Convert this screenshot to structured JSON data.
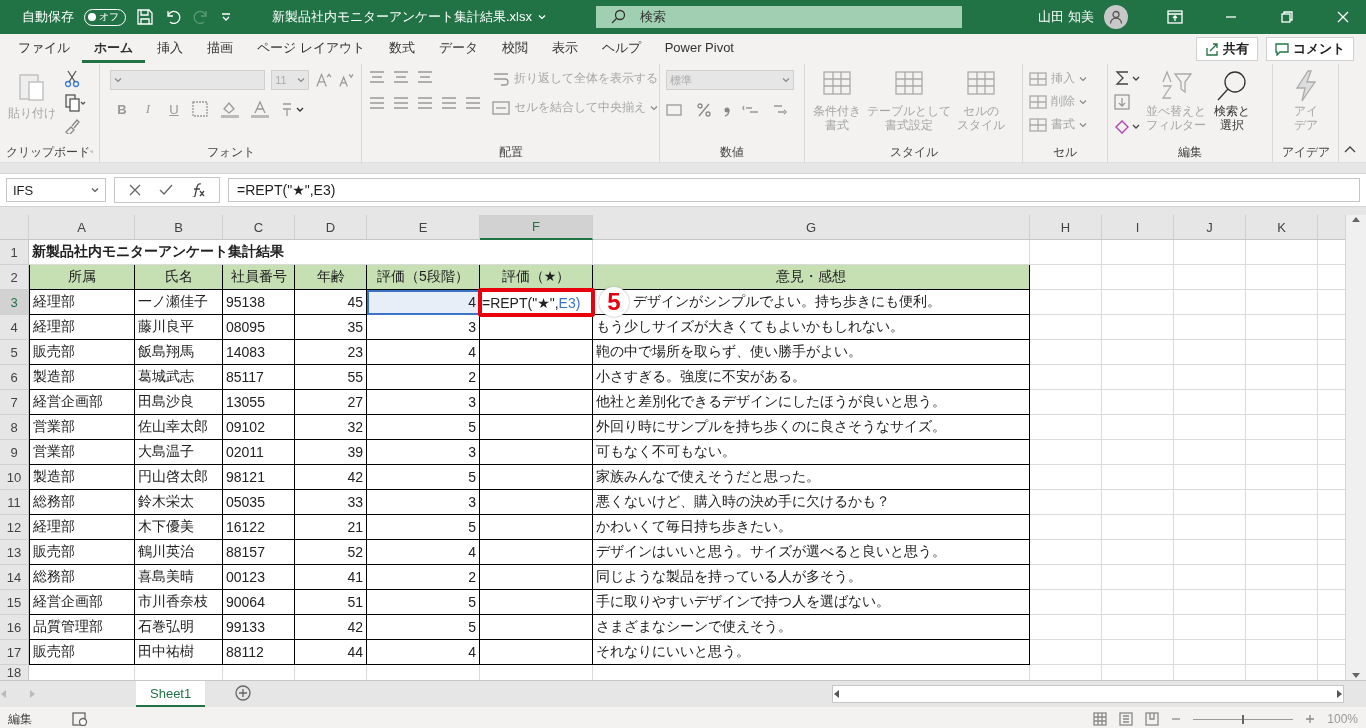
{
  "title_bar": {
    "autosave_label": "自動保存",
    "autosave_toggle": {
      "label": "オフ",
      "on": false
    },
    "file_name": "新製品社内モニターアンケート集計結果.xlsx",
    "search_placeholder": "検索",
    "user_name": "山田 知美"
  },
  "menu_tabs": [
    {
      "label": "ファイル",
      "selected": false
    },
    {
      "label": "ホーム",
      "selected": true
    },
    {
      "label": "挿入",
      "selected": false
    },
    {
      "label": "描画",
      "selected": false
    },
    {
      "label": "ページ レイアウト",
      "selected": false
    },
    {
      "label": "数式",
      "selected": false
    },
    {
      "label": "データ",
      "selected": false
    },
    {
      "label": "校閲",
      "selected": false
    },
    {
      "label": "表示",
      "selected": false
    },
    {
      "label": "ヘルプ",
      "selected": false
    },
    {
      "label": "Power Pivot",
      "selected": false
    }
  ],
  "share_button": "共有",
  "comment_button": "コメント",
  "ribbon": {
    "clipboard": {
      "title": "クリップボード",
      "paste": {
        "label": "貼り付け",
        "disabled": true
      }
    },
    "font": {
      "title": "フォント",
      "font_size": "11",
      "format_buttons": [
        "B",
        "I",
        "U"
      ]
    },
    "alignment": {
      "title": "配置",
      "wrap": {
        "label": "折り返して全体を表示する",
        "disabled": true
      },
      "merge": {
        "label": "セルを結合して中央揃え",
        "disabled": true
      }
    },
    "number": {
      "title": "数値",
      "format": "標準"
    },
    "styles": {
      "title": "スタイル",
      "buttons": [
        {
          "lines": [
            "条件付き",
            "書式"
          ],
          "disabled": true
        },
        {
          "lines": [
            "テーブルとして",
            "書式設定"
          ],
          "disabled": true
        },
        {
          "lines": [
            "セルの",
            "スタイル"
          ],
          "disabled": true
        }
      ]
    },
    "cells": {
      "title": "セル",
      "buttons": [
        {
          "label": "挿入",
          "disabled": true
        },
        {
          "label": "削除",
          "disabled": true
        },
        {
          "label": "書式",
          "disabled": true
        }
      ]
    },
    "editing": {
      "title": "編集",
      "buttons": [
        {
          "lines": [
            "並べ替えと",
            "フィルター"
          ],
          "disabled": true
        },
        {
          "lines": [
            "検索と",
            "選択"
          ],
          "disabled": false
        }
      ]
    },
    "ideas": {
      "title": "アイデア",
      "button": {
        "lines": [
          "アイ",
          "デア"
        ],
        "disabled": true
      }
    }
  },
  "formula_bar": {
    "name_box": "IFS",
    "formula": "=REPT(\"★\",E3)"
  },
  "columns": [
    {
      "label": "A",
      "selected": false
    },
    {
      "label": "B",
      "selected": false
    },
    {
      "label": "C",
      "selected": false
    },
    {
      "label": "D",
      "selected": false
    },
    {
      "label": "E",
      "selected": false
    },
    {
      "label": "F",
      "selected": true
    },
    {
      "label": "G",
      "selected": false
    },
    {
      "label": "H",
      "selected": false
    },
    {
      "label": "I",
      "selected": false
    },
    {
      "label": "J",
      "selected": false
    },
    {
      "label": "K",
      "selected": false
    }
  ],
  "rows": [
    {
      "number": "1",
      "selected": false,
      "kind": "title",
      "title": "新製品社内モニターアンケート集計結果"
    },
    {
      "number": "2",
      "selected": false,
      "kind": "header",
      "cells": [
        "所属",
        "氏名",
        "社員番号",
        "年齢",
        "評価（5段階）",
        "評価（★）",
        "意見・感想"
      ]
    },
    {
      "number": "3",
      "selected": true,
      "kind": "data",
      "referenced": true,
      "dept": "経理部",
      "name": "一ノ瀬佳子",
      "id": "95138",
      "age": "45",
      "rating": "4",
      "editing": [
        {
          "text": "=REPT(\"★\","
        },
        {
          "text": "E3)",
          "kind": "reference"
        }
      ],
      "comment": "デザインがシンプルでよい。持ち歩きにも便利。",
      "callout": "5"
    },
    {
      "number": "4",
      "selected": false,
      "kind": "data",
      "referenced": false,
      "dept": "経理部",
      "name": "藤川良平",
      "id": "08095",
      "age": "35",
      "rating": "3",
      "comment": "もう少しサイズが大きくてもよいかもしれない。"
    },
    {
      "number": "5",
      "selected": false,
      "kind": "data",
      "referenced": false,
      "dept": "販売部",
      "name": "飯島翔馬",
      "id": "14083",
      "age": "23",
      "rating": "4",
      "comment": "鞄の中で場所を取らず、使い勝手がよい。"
    },
    {
      "number": "6",
      "selected": false,
      "kind": "data",
      "referenced": false,
      "dept": "製造部",
      "name": "葛城武志",
      "id": "85117",
      "age": "55",
      "rating": "2",
      "comment": "小さすぎる。強度に不安がある。"
    },
    {
      "number": "7",
      "selected": false,
      "kind": "data",
      "referenced": false,
      "dept": "経営企画部",
      "name": "田島沙良",
      "id": "13055",
      "age": "27",
      "rating": "3",
      "comment": "他社と差別化できるデザインにしたほうが良いと思う。"
    },
    {
      "number": "8",
      "selected": false,
      "kind": "data",
      "referenced": false,
      "dept": "営業部",
      "name": "佐山幸太郎",
      "id": "09102",
      "age": "32",
      "rating": "5",
      "comment": "外回り時にサンプルを持ち歩くのに良さそうなサイズ。"
    },
    {
      "number": "9",
      "selected": false,
      "kind": "data",
      "referenced": false,
      "dept": "営業部",
      "name": "大島温子",
      "id": "02011",
      "age": "39",
      "rating": "3",
      "comment": "可もなく不可もない。"
    },
    {
      "number": "10",
      "selected": false,
      "kind": "data",
      "referenced": false,
      "dept": "製造部",
      "name": "円山啓太郎",
      "id": "98121",
      "age": "42",
      "rating": "5",
      "comment": "家族みんなで使えそうだと思った。"
    },
    {
      "number": "11",
      "selected": false,
      "kind": "data",
      "referenced": false,
      "dept": "総務部",
      "name": "鈴木栄太",
      "id": "05035",
      "age": "33",
      "rating": "3",
      "comment": "悪くないけど、購入時の決め手に欠けるかも？"
    },
    {
      "number": "12",
      "selected": false,
      "kind": "data",
      "referenced": false,
      "dept": "経理部",
      "name": "木下優美",
      "id": "16122",
      "age": "21",
      "rating": "5",
      "comment": "かわいくて毎日持ち歩きたい。"
    },
    {
      "number": "13",
      "selected": false,
      "kind": "data",
      "referenced": false,
      "dept": "販売部",
      "name": "鶴川英治",
      "id": "88157",
      "age": "52",
      "rating": "4",
      "comment": "デザインはいいと思う。サイズが選べると良いと思う。"
    },
    {
      "number": "14",
      "selected": false,
      "kind": "data",
      "referenced": false,
      "dept": "総務部",
      "name": "喜島美晴",
      "id": "00123",
      "age": "41",
      "rating": "2",
      "comment": "同じような製品を持っている人が多そう。"
    },
    {
      "number": "15",
      "selected": false,
      "kind": "data",
      "referenced": false,
      "dept": "経営企画部",
      "name": "市川香奈枝",
      "id": "90064",
      "age": "51",
      "rating": "5",
      "comment": "手に取りやすいデザインで持つ人を選ばない。"
    },
    {
      "number": "16",
      "selected": false,
      "kind": "data",
      "referenced": false,
      "dept": "品質管理部",
      "name": "石巻弘明",
      "id": "99133",
      "age": "42",
      "rating": "5",
      "comment": "さまざまなシーンで使えそう。"
    },
    {
      "number": "17",
      "selected": false,
      "kind": "data",
      "referenced": false,
      "dept": "販売部",
      "name": "田中祐樹",
      "id": "88112",
      "age": "44",
      "rating": "4",
      "comment": "それなりにいいと思う。"
    },
    {
      "number": "18",
      "selected": false,
      "kind": "empty"
    }
  ],
  "sheet_tabs": [
    {
      "label": "Sheet1",
      "selected": true
    }
  ],
  "status_bar": {
    "mode": "編集",
    "zoom": "100%",
    "zoom_slider": {
      "level": 0.5
    }
  }
}
